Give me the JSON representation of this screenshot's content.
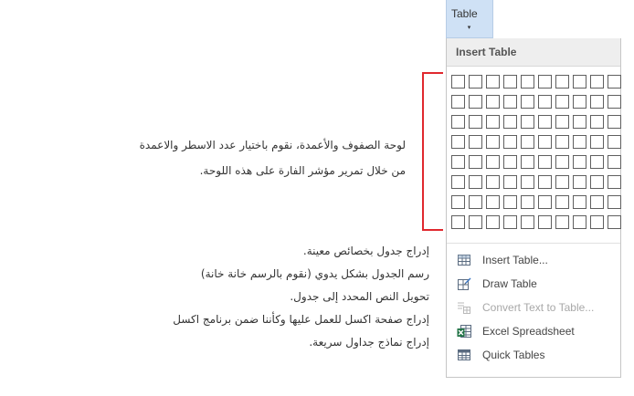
{
  "ribbon": {
    "table_label": "Table",
    "caret": "▾"
  },
  "menu": {
    "header": "Insert Table",
    "grid": {
      "columns": 10,
      "rows": 8
    },
    "items": [
      {
        "label": "Insert Table...",
        "icon": "insert-table-icon",
        "enabled": true
      },
      {
        "label": "Draw Table",
        "icon": "draw-table-icon",
        "enabled": true
      },
      {
        "label": "Convert Text to Table...",
        "icon": "convert-text-icon",
        "enabled": false
      },
      {
        "label": "Excel Spreadsheet",
        "icon": "excel-spreadsheet-icon",
        "enabled": true
      },
      {
        "label": "Quick Tables",
        "icon": "quick-tables-icon",
        "enabled": true
      }
    ]
  },
  "annotations": {
    "grid_line1": "لوحة الصفوف والأعمدة، نقوم باختيار عدد الاسطر والاعمدة",
    "grid_line2": "من خلال تمرير مؤشر الفارة على هذه اللوحة.",
    "items": [
      "إدراج جدول بخصائص معينة.",
      "رسم الجدول بشكل يدوي (نقوم بالرسم خانة خانة)",
      "تحويل النص المحدد إلى جدول.",
      "إدراج صفحة اكسل للعمل عليها وكأننا ضمن برنامج اكسل",
      "إدراج نماذج جداول سريعة."
    ]
  },
  "colors": {
    "accent_red": "#e0282e",
    "ribbon_blue": "#cfe1f5",
    "excel_green": "#217346"
  }
}
